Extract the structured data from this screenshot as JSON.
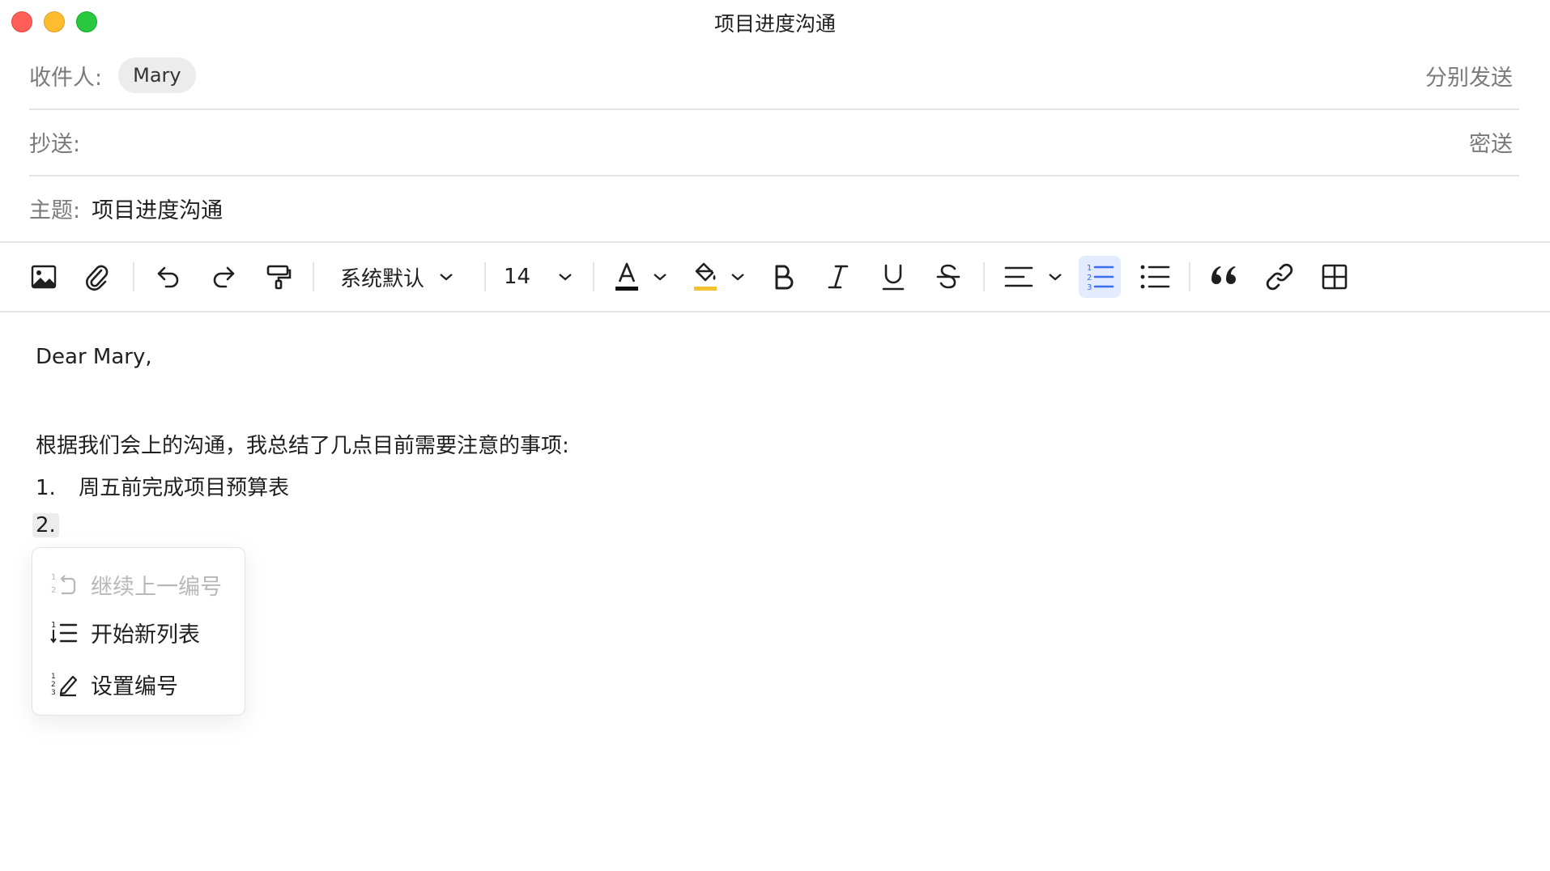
{
  "window": {
    "title": "项目进度沟通"
  },
  "header": {
    "to_label": "收件人:",
    "to_recipient": "Mary",
    "send_separately": "分别发送",
    "cc_label": "抄送:",
    "bcc": "密送",
    "subject_label": "主题:",
    "subject_value": "项目进度沟通"
  },
  "toolbar": {
    "font_family": "系统默认",
    "font_size": "14",
    "text_color": "#111111",
    "highlight_color": "#f5c12e",
    "active_accent": "#3b6df6"
  },
  "body": {
    "greeting": "Dear Mary,",
    "intro": "根据我们会上的沟通，我总结了几点目前需要注意的事项:",
    "items": [
      {
        "num": "1.",
        "text": "周五前完成项目预算表"
      },
      {
        "num": "2.",
        "text": ""
      }
    ]
  },
  "context_menu": {
    "items": [
      {
        "label": "继续上一编号",
        "icon": "continue-numbering-icon",
        "disabled": true
      },
      {
        "label": "开始新列表",
        "icon": "new-list-icon",
        "disabled": false
      },
      {
        "label": "设置编号",
        "icon": "set-numbering-icon",
        "disabled": false
      }
    ]
  }
}
